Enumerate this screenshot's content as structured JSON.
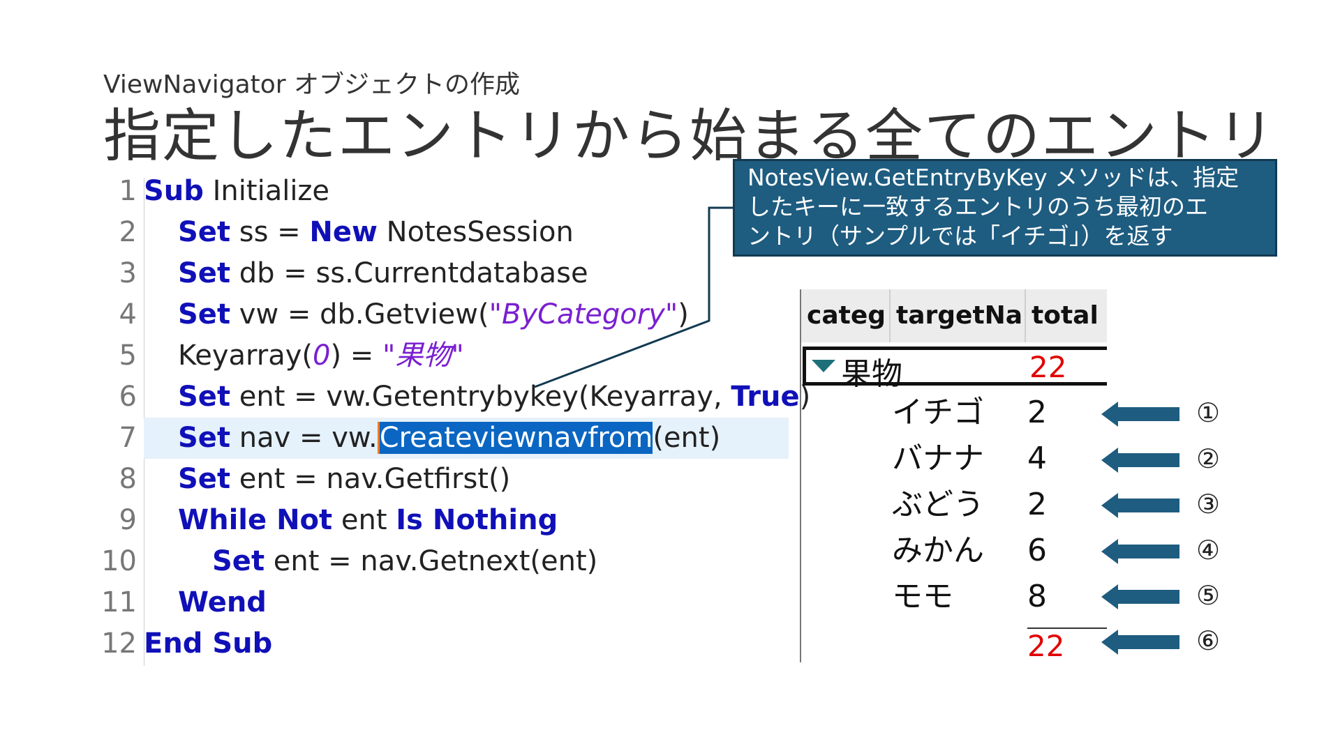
{
  "slide": {
    "subtitle": "ViewNavigator オブジェクトの作成",
    "title": "指定したエントリから始まる全てのエントリ"
  },
  "code": {
    "line_numbers": [
      "1",
      "2",
      "3",
      "4",
      "5",
      "6",
      "7",
      "8",
      "9",
      "10",
      "11",
      "12"
    ],
    "lines": [
      {
        "kw1": "Sub",
        "rest": " Initialize"
      },
      {
        "kw1": "Set",
        "rest1": " ss = ",
        "kw2": "New",
        "rest2": " NotesSession"
      },
      {
        "kw1": "Set",
        "rest": " db = ss.Currentdatabase"
      },
      {
        "kw1": "Set",
        "rest1": " vw = db.Getview(",
        "str": "\"ByCategory\"",
        "rest2": ")"
      },
      {
        "rest1": "Keyarray(",
        "num": "0",
        "rest2": ") = ",
        "str": "\"果物\""
      },
      {
        "kw1": "Set",
        "rest1": " ent = vw.Getentrybykey(Keyarray, ",
        "kw2": "True",
        "rest2": ")"
      },
      {
        "kw1": "Set",
        "rest1": " nav = vw.",
        "sel": "Createviewnavfrom",
        "rest2": "(ent)"
      },
      {
        "kw1": "Set",
        "rest": " ent = nav.Getfirst()"
      },
      {
        "kw1": "While Not",
        "rest1": " ent ",
        "kw2": "Is Nothing"
      },
      {
        "kw1": "Set",
        "rest": " ent = nav.Getnext(ent)"
      },
      {
        "kw1": "Wend"
      },
      {
        "kw1": "End Sub"
      }
    ]
  },
  "callout": {
    "line1": "NotesView.GetEntryByKey メソッドは、指定",
    "line2": "したキーに一致するエントリのうち最初のエ",
    "line3": "ントリ（サンプルでは「イチゴ」）を返す"
  },
  "view": {
    "headers": [
      "categ",
      "targetNam",
      "total"
    ],
    "category": {
      "name": "果物",
      "total": "22"
    },
    "rows": [
      {
        "name": "イチゴ",
        "total": "2",
        "marker": "①"
      },
      {
        "name": "バナナ",
        "total": "4",
        "marker": "②"
      },
      {
        "name": "ぶどう",
        "total": "2",
        "marker": "③"
      },
      {
        "name": "みかん",
        "total": "6",
        "marker": "④"
      },
      {
        "name": "モモ",
        "total": "8",
        "marker": "⑤"
      }
    ],
    "sum": {
      "total": "22",
      "marker": "⑥"
    }
  },
  "colors": {
    "keyword": "#1010b8",
    "string": "#7a1fd1",
    "selection": "#0a66c2",
    "callout_bg": "#1e5c80",
    "arrow": "#1e5c80",
    "total_red": "#e10000"
  }
}
